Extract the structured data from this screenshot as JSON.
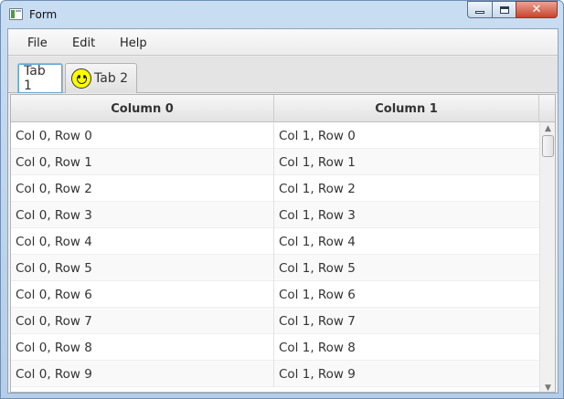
{
  "window": {
    "title": "Form",
    "close_glyph": "✕"
  },
  "menubar": {
    "items": [
      "File",
      "Edit",
      "Help"
    ]
  },
  "tabs": [
    {
      "label": "Tab 1",
      "active": true
    },
    {
      "label": "Tab 2",
      "active": false,
      "icon": "smiley-icon"
    }
  ],
  "table": {
    "columns": [
      "Column 0",
      "Column 1"
    ],
    "rows": [
      [
        "Col 0, Row 0",
        "Col 1, Row 0"
      ],
      [
        "Col 0, Row 1",
        "Col 1, Row 1"
      ],
      [
        "Col 0, Row 2",
        "Col 1, Row 2"
      ],
      [
        "Col 0, Row 3",
        "Col 1, Row 3"
      ],
      [
        "Col 0, Row 4",
        "Col 1, Row 4"
      ],
      [
        "Col 0, Row 5",
        "Col 1, Row 5"
      ],
      [
        "Col 0, Row 6",
        "Col 1, Row 6"
      ],
      [
        "Col 0, Row 7",
        "Col 1, Row 7"
      ],
      [
        "Col 0, Row 8",
        "Col 1, Row 8"
      ],
      [
        "Col 0, Row 9",
        "Col 1, Row 9"
      ]
    ]
  },
  "scrollbar": {
    "up_glyph": "▲",
    "down_glyph": "▼"
  }
}
